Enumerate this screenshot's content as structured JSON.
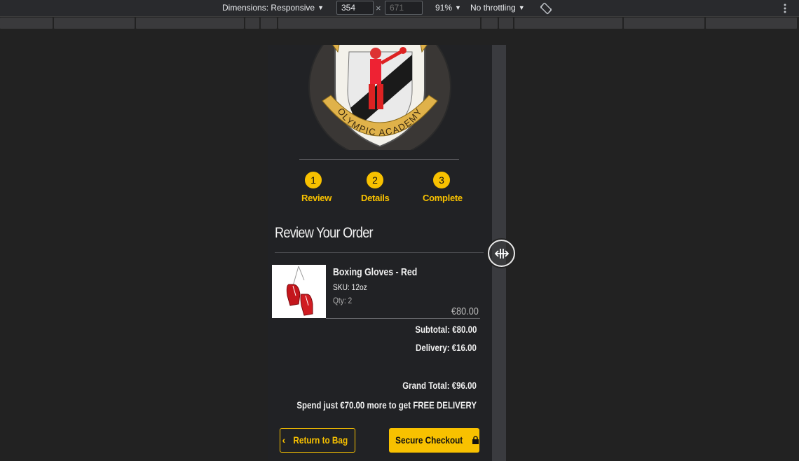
{
  "devtools": {
    "dimensions_label": "Dimensions: Responsive",
    "width_value": "354",
    "height_placeholder": "671",
    "times_sign": "×",
    "zoom_label": "91%",
    "throttling_label": "No throttling"
  },
  "icons": {
    "rotate": "rotate-icon",
    "more": "more-vert-icon",
    "resize": "resize-handle-icon",
    "lock": "lock-icon",
    "chevron": "chevron-left-icon"
  },
  "logo": {
    "text": "OLYMPIC ACADEMY"
  },
  "steps": [
    {
      "number": "1",
      "label": "Review"
    },
    {
      "number": "2",
      "label": "Details"
    },
    {
      "number": "3",
      "label": "Complete"
    }
  ],
  "page": {
    "title": "Review Your Order"
  },
  "item": {
    "name": "Boxing Gloves - Red",
    "sku": "SKU: 12oz",
    "qty": "Qty: 2",
    "price": "€80.00"
  },
  "summary": {
    "subtotal": "Subtotal: €80.00",
    "delivery": "Delivery: €16.00",
    "grand_total": "Grand Total: €96.00",
    "free_delivery_msg": "Spend just €70.00 more to get FREE DELIVERY"
  },
  "buttons": {
    "back": "Return to Bag",
    "checkout": "Secure Checkout"
  },
  "colors": {
    "accent": "#f8c100",
    "background": "#212225"
  }
}
